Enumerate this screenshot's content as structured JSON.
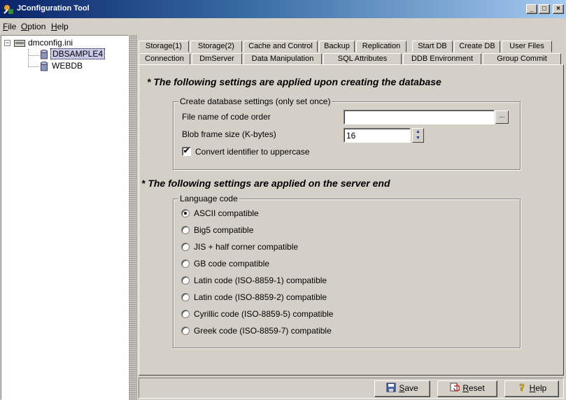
{
  "window": {
    "title": "JConfiguration Tool",
    "controls": {
      "minimize": "_",
      "maximize": "□",
      "close": "×"
    }
  },
  "menu": [
    {
      "label": "File",
      "mnemonic": "F",
      "rest": "ile"
    },
    {
      "label": "Option",
      "mnemonic": "O",
      "rest": "ption"
    },
    {
      "label": "Help",
      "mnemonic": "H",
      "rest": "elp"
    }
  ],
  "tree": {
    "root": {
      "label": "dmconfig.ini",
      "expander": "−"
    },
    "children": [
      {
        "label": "DBSAMPLE4",
        "selected": true
      },
      {
        "label": "WEBDB",
        "selected": false
      }
    ]
  },
  "tabs": {
    "row1": [
      "Storage(1)",
      "Storage(2)",
      "Cache and Control",
      "Backup",
      "Replication",
      "Start DB",
      "Create DB",
      "User Files"
    ],
    "row2": [
      "Connection",
      "DmServer",
      "Data Manipulation",
      "SQL Attributes",
      "DDB Environment",
      "Group Commit"
    ],
    "active": "Create DB"
  },
  "create_section": {
    "title": "* The following settings are applied upon creating the database",
    "group_title": "Create database settings (only set once)",
    "code_order_label": "File name of code order",
    "code_order_value": "",
    "browse_label": "...",
    "blob_label": "Blob frame size (K-bytes)",
    "blob_value": "16",
    "convert_label": "Convert identifier to uppercase",
    "convert_checked": true
  },
  "server_section": {
    "title": "* The following settings are applied on the server end",
    "group_title": "Language code",
    "options": [
      {
        "label": "ASCII compatible",
        "checked": true
      },
      {
        "label": "Big5 compatible",
        "checked": false
      },
      {
        "label": "JIS + half corner compatible",
        "checked": false
      },
      {
        "label": "GB code compatible",
        "checked": false
      },
      {
        "label": "Latin code (ISO-8859-1) compatible",
        "checked": false
      },
      {
        "label": "Latin code (ISO-8859-2) compatible",
        "checked": false
      },
      {
        "label": "Cyrillic code (ISO-8859-5) compatible",
        "checked": false
      },
      {
        "label": "Greek code (ISO-8859-7) compatible",
        "checked": false
      }
    ]
  },
  "buttons": {
    "save": {
      "mnemonic": "S",
      "rest": "ave"
    },
    "reset": {
      "mnemonic": "R",
      "rest": "eset"
    },
    "help": {
      "mnemonic": "H",
      "rest": "elp"
    }
  },
  "colors": {
    "titlebar_start": "#0a246a",
    "titlebar_end": "#a6caf0",
    "face": "#d4d0c8",
    "selection": "#c8c8e8"
  }
}
